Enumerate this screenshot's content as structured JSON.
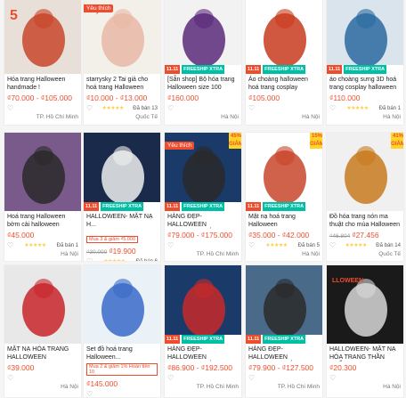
{
  "products": [
    {
      "title": "Hóa trang Halloween handmade !",
      "price": "₫70.000 - ₫105.000",
      "old_price": "",
      "location": "TP. Hồ Chí Minh",
      "favorite": "",
      "discount": "",
      "sold": "",
      "tag": "",
      "overlay": "5",
      "promo": false,
      "colors": [
        "#e8e0d8",
        "#c8452a"
      ]
    },
    {
      "title": "starrysky 2 Tai giả cho hoá trang Halloween",
      "price": "₫10.000 - ₫13.000",
      "old_price": "",
      "location": "Quốc Tế",
      "favorite": "Yêu thích",
      "discount": "",
      "sold": "Đã bán 13",
      "tag": "",
      "overlay": "sky. vn",
      "promo": false,
      "colors": [
        "#f3efe9",
        "#e8b9a6"
      ]
    },
    {
      "title": "[Sẵn shop] Bộ hóa trang Halloween size 100",
      "price": "₫160.000",
      "old_price": "",
      "location": "Hà Nội",
      "favorite": "",
      "discount": "",
      "sold": "",
      "tag": "",
      "overlay": "",
      "promo": true,
      "colors": [
        "#f2f2f2",
        "#5a2a7a"
      ]
    },
    {
      "title": "Áo choàng halloween hoá trang cosplay",
      "price": "₫105.000",
      "old_price": "",
      "location": "Hà Nội",
      "favorite": "",
      "discount": "",
      "sold": "",
      "tag": "",
      "overlay": "",
      "promo": true,
      "colors": [
        "#ffffff",
        "#c83a1e"
      ]
    },
    {
      "title": "áo choàng sưng 3D hoá trang cosplay halloween",
      "price": "₫110.000",
      "old_price": "",
      "location": "Hà Nội",
      "favorite": "",
      "discount": "",
      "sold": "Đã bán 1",
      "tag": "",
      "overlay": "",
      "promo": true,
      "colors": [
        "#d9e4ec",
        "#2a6aa0"
      ]
    },
    {
      "title": "Hoá trang Halloween bờm cài halloween",
      "price": "₫45.000",
      "old_price": "",
      "location": "Hà Nội",
      "favorite": "",
      "discount": "",
      "sold": "Đã bán 1",
      "tag": "",
      "overlay": "",
      "promo": false,
      "colors": [
        "#7a5a8a",
        "#2a2a2a"
      ]
    },
    {
      "title": "HALLOWEEN- MẶT NẠ H...",
      "price": "₫19.900",
      "old_price": "₫30.000",
      "location": "Hà Nội",
      "favorite": "",
      "discount": "",
      "sold": "Đã bán 6",
      "tag": "Mua 3 & giảm ₫5.000",
      "overlay": "",
      "promo": true,
      "colors": [
        "#1a2a4a",
        "#eeeeee"
      ]
    },
    {
      "title": "HÀNG ĐẸP- HALLOWEEN HALLOWEEN ÁO...",
      "price": "₫79.000 - ₫175.000",
      "old_price": "",
      "location": "TP. Hồ Chí Minh",
      "favorite": "Yêu thích",
      "discount": "45% GIẢM",
      "sold": "",
      "tag": "",
      "overlay": "",
      "promo": true,
      "colors": [
        "#1a3a6a",
        "#2a2a2a"
      ]
    },
    {
      "title": "Mặt nạ hoá trang Halloween",
      "price": "₫35.000 - ₫42.000",
      "old_price": "",
      "location": "Hà Nội",
      "favorite": "",
      "discount": "15% GIẢM",
      "sold": "Đã bán 5",
      "tag": "",
      "overlay": "",
      "promo": true,
      "colors": [
        "#ffffff",
        "#c8452a"
      ]
    },
    {
      "title": "Đồ hóa trang nón ma thuật cho mùa Halloween",
      "price": "₫27.456",
      "old_price": "₫46.804",
      "location": "Quốc Tế",
      "favorite": "",
      "discount": "41% GIẢM",
      "sold": "Đã bán 14",
      "tag": "",
      "overlay": "",
      "promo": false,
      "colors": [
        "#f0f0f0",
        "#c87a1e"
      ]
    },
    {
      "title": "MẶT NẠ HÓA TRANG HALLOWEEN",
      "price": "₫39.000",
      "old_price": "",
      "location": "Hà Nội",
      "favorite": "",
      "discount": "",
      "sold": "",
      "tag": "",
      "overlay": "",
      "promo": false,
      "colors": [
        "#e8e8e8",
        "#c8252a"
      ]
    },
    {
      "title": "Set đồ hoá trang Halloween...",
      "price": "₫145.000",
      "old_price": "",
      "location": "TP. Hồ Chí Minh",
      "favorite": "",
      "discount": "",
      "sold": "",
      "tag": "Mua 2 & giảm 1% Hoàn tiền 10",
      "overlay": "",
      "promo": false,
      "colors": [
        "#eaf2f8",
        "#3a6ac8"
      ]
    },
    {
      "title": "HÀNG ĐẸP- HALLOWEEN HALLOWEEN ÁO...",
      "price": "₫86.900 - ₫192.500",
      "old_price": "",
      "location": "TP. Hồ Chí Minh",
      "favorite": "",
      "discount": "",
      "sold": "",
      "tag": "",
      "overlay": "",
      "promo": true,
      "colors": [
        "#1a3a6a",
        "#c82a2a"
      ]
    },
    {
      "title": "HÀNG ĐẸP- HALLOWEEN HALLOWEEN ÁO...",
      "price": "₫79.900 - ₫127.500",
      "old_price": "",
      "location": "TP. Hồ Chí Minh",
      "favorite": "",
      "discount": "",
      "sold": "",
      "tag": "",
      "overlay": "",
      "promo": true,
      "colors": [
        "#4a6a8a",
        "#2a2a2a"
      ]
    },
    {
      "title": "HALLOWEEN- MẶT NẠ HÓA TRANG THẦN CHẾ...",
      "price": "₫20.300",
      "old_price": "",
      "location": "Hà Nội",
      "favorite": "",
      "discount": "",
      "sold": "",
      "tag": "",
      "overlay": "LLOWEEN",
      "promo": false,
      "colors": [
        "#1a1a1a",
        "#d8d8d8"
      ]
    }
  ],
  "ui": {
    "promo_badge_1": "11.11",
    "promo_badge_2": "FREESHIP XTRA",
    "stars": "★★★★★"
  }
}
